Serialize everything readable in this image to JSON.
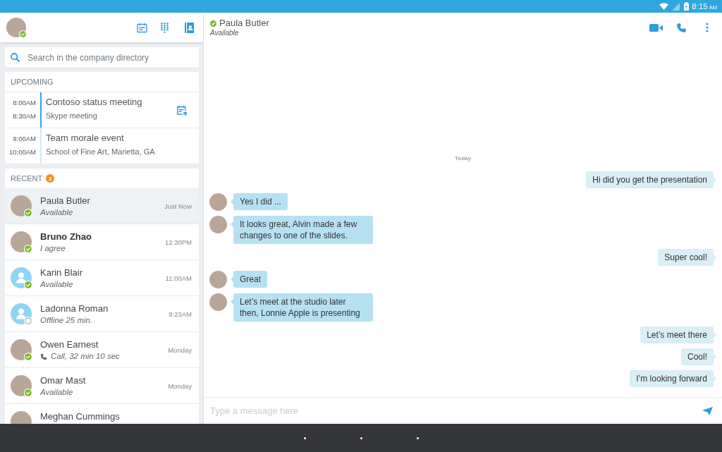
{
  "status_bar": {
    "time": "8:15",
    "period": "AM"
  },
  "sidebar": {
    "profile": {
      "available": true
    },
    "search": {
      "placeholder": "Search in the company directory"
    },
    "upcoming": {
      "title": "UPCOMING",
      "meetings": [
        {
          "start": "8:00AM",
          "end": "8:30AM",
          "title": "Contoso status meeting",
          "subtitle": "Skype meeting",
          "active": true,
          "joinable": true
        },
        {
          "start": "9:00AM",
          "end": "10:00AM",
          "title": "Team morale event",
          "subtitle": "School of Fine Art, Marietta, GA",
          "active": false,
          "joinable": false
        }
      ]
    },
    "recent": {
      "title": "RECENT",
      "unread_count": "2",
      "contacts": [
        {
          "kind": "photo",
          "name": "Paula Butler",
          "status": "Available",
          "time": "Just Now",
          "available": true,
          "call": false,
          "selected": true,
          "unread": false
        },
        {
          "kind": "photo",
          "name": "Bruno Zhao",
          "status": "I agree",
          "time": "12:30PM",
          "available": true,
          "call": false,
          "selected": false,
          "unread": true
        },
        {
          "kind": "placeholder",
          "name": "Karin Blair",
          "status": "Available",
          "time": "11:00AM",
          "available": true,
          "call": false,
          "selected": false,
          "unread": false
        },
        {
          "kind": "placeholder",
          "name": "Ladonna Roman",
          "status": "Offline 25 min.",
          "time": "9:23AM",
          "available": false,
          "call": false,
          "selected": false,
          "unread": false
        },
        {
          "kind": "photo",
          "name": "Owen Earnest",
          "status": "Call, 32 min 10 sec",
          "time": "Monday",
          "available": true,
          "call": true,
          "selected": false,
          "unread": false
        },
        {
          "kind": "photo",
          "name": "Omar Mast",
          "status": "Available",
          "time": "Monday",
          "available": true,
          "call": false,
          "selected": false,
          "unread": false
        },
        {
          "kind": "photo",
          "name": "Meghan Cummings",
          "selected": false,
          "unread": false
        }
      ]
    }
  },
  "conversation": {
    "contact": {
      "name": "Paula Butler",
      "status": "Available",
      "available": true
    },
    "day": "Today",
    "messages": [
      {
        "kind": "outgoing",
        "text": "Hi did you get the presentation"
      },
      {
        "kind": "incoming",
        "text": "Yes I did ..."
      },
      {
        "kind": "incoming",
        "text": "It looks great, Alvin made a few changes to one of the slides."
      },
      {
        "kind": "outgoing",
        "text": "Super cool!"
      },
      {
        "kind": "incoming",
        "text": "Great"
      },
      {
        "kind": "incoming",
        "text": "Let’s meet at the studio later then, Lonnie Apple is presenting"
      },
      {
        "kind": "outgoing",
        "text": "Let’s meet there"
      },
      {
        "kind": "outgoing",
        "text": "Cool!"
      },
      {
        "kind": "outgoing",
        "text": "I’m looking forward"
      }
    ],
    "composer": {
      "placeholder": "Type a message here"
    }
  }
}
